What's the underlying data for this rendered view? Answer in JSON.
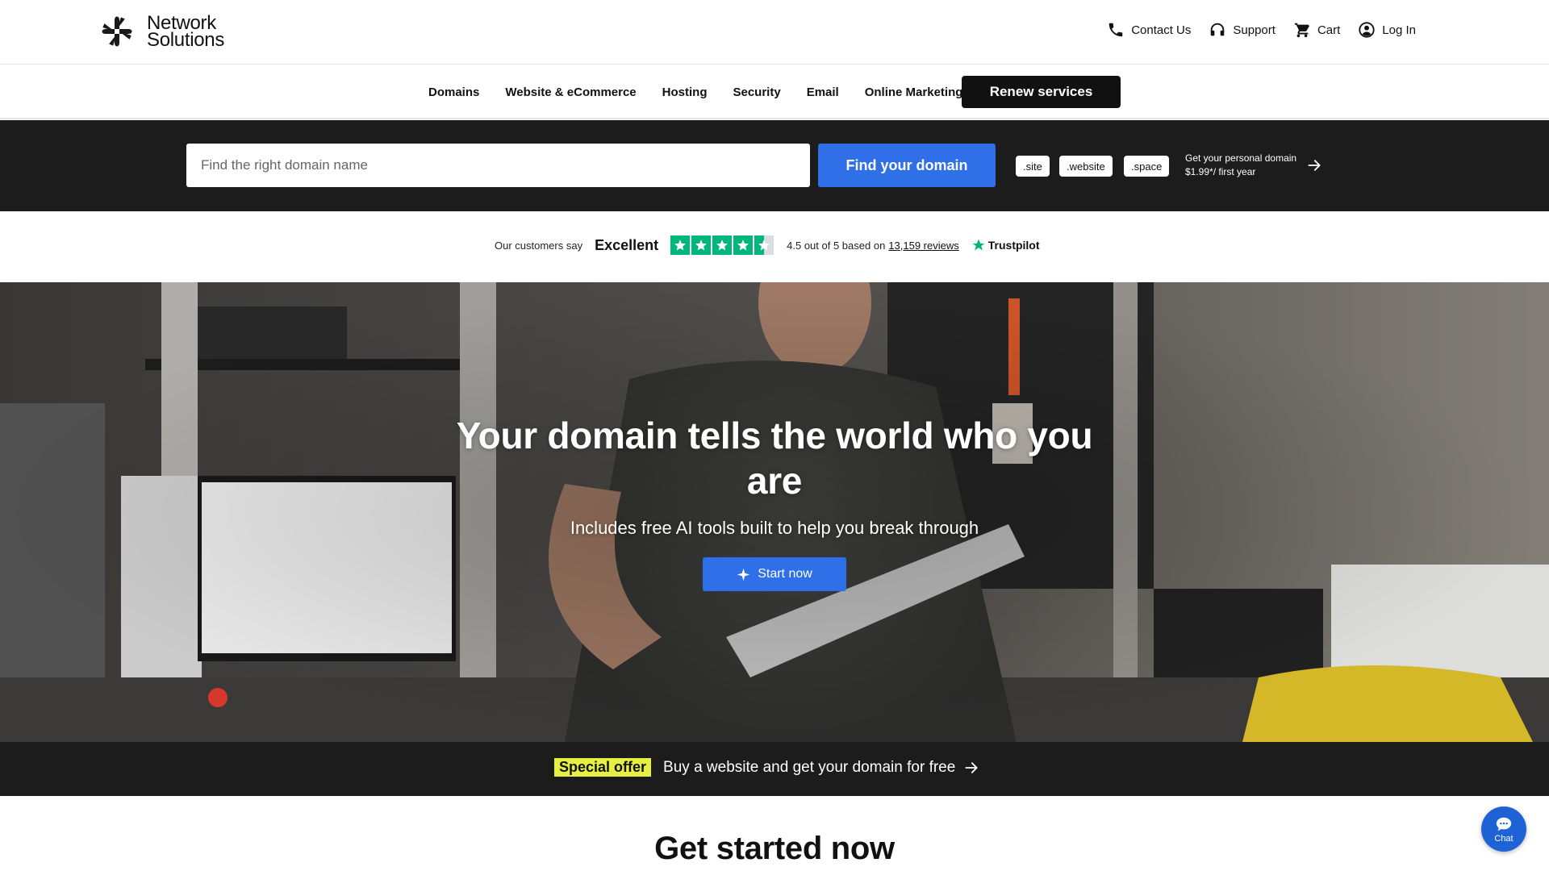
{
  "header": {
    "logo_line1": "Network",
    "logo_line2": "Solutions",
    "utility": [
      {
        "label": "Contact Us",
        "icon": "phone-icon"
      },
      {
        "label": "Support",
        "icon": "headset-icon"
      },
      {
        "label": "Cart",
        "icon": "cart-icon"
      },
      {
        "label": "Log In",
        "icon": "user-circle-icon"
      }
    ]
  },
  "nav": {
    "items": [
      "Domains",
      "Website & eCommerce",
      "Hosting",
      "Security",
      "Email",
      "Online Marketing"
    ],
    "renew_label": "Renew services"
  },
  "search": {
    "placeholder": "Find the right domain name",
    "value": "",
    "button_label": "Find your domain",
    "tlds": [
      ".site",
      ".website",
      ".space"
    ],
    "promo_line1": "Get your personal domain",
    "promo_line2": "$1.99*/ first year"
  },
  "trust": {
    "customers_say": "Our customers say",
    "rating_word": "Excellent",
    "score_text": "4.5 out of 5 based on",
    "reviews_link": "13,159 reviews",
    "brand": "Trustpilot",
    "rating_value": 4.5
  },
  "hero": {
    "title": "Your domain tells the world who you are",
    "subtitle": "Includes free AI tools built to help you break through",
    "cta_label": "Start now"
  },
  "offer": {
    "badge": "Special offer",
    "text": "Buy a website and get your domain for free"
  },
  "section": {
    "title": "Get started now"
  },
  "chat": {
    "label": "Chat"
  },
  "colors": {
    "accent_blue": "#2f6fe8",
    "dark_band": "#1c1c1c",
    "trustpilot_green": "#00b67a",
    "offer_yellow": "#e6f043"
  }
}
